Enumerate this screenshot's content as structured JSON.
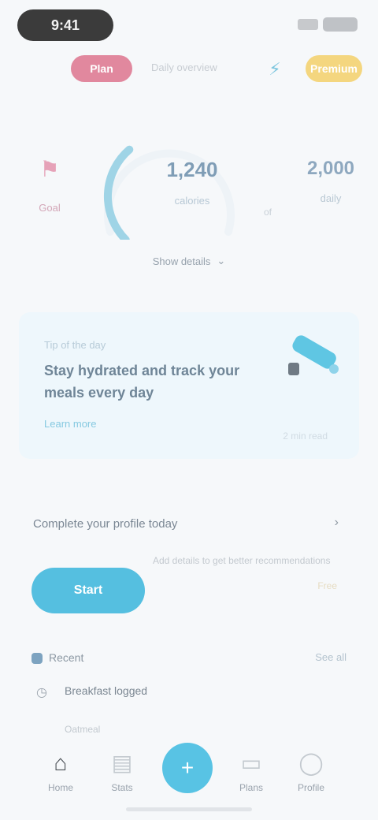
{
  "statusbar": {
    "time": "9:41",
    "signal_icon": "signal-icon",
    "battery_icon": "battery-icon"
  },
  "header": {
    "left_chip": "Plan",
    "center_text": "Daily overview",
    "right_icon": "bolt-icon",
    "right_chip": "Premium"
  },
  "dashboard": {
    "left_stat_label": "Goal",
    "gauge_progress": 0.35,
    "mid_stat_value": "1,240",
    "mid_stat_label": "calories",
    "separator_text": "of",
    "right_stat_value": "2,000",
    "right_stat_label": "daily",
    "details_toggle": "Show details"
  },
  "promo": {
    "subtitle": "Tip of the day",
    "title": "Stay hydrated and track your meals every day",
    "link": "Learn more",
    "meta": "2 min read"
  },
  "info": {
    "heading": "Complete your profile today",
    "arrow": "›",
    "description": "Add details to get better recommendations",
    "cta_label": "Start",
    "note": "Free"
  },
  "section": {
    "title": "Recent",
    "more": "See all",
    "items": [
      {
        "icon": "clock-icon",
        "label": "Breakfast logged"
      },
      {
        "icon": "note-icon",
        "label": "Oatmeal"
      }
    ]
  },
  "bottom_nav": {
    "items": [
      {
        "icon": "home-icon",
        "label": "Home"
      },
      {
        "icon": "chart-icon",
        "label": "Stats"
      },
      {
        "icon": "plus-icon",
        "label": ""
      },
      {
        "icon": "book-icon",
        "label": "Plans"
      },
      {
        "icon": "user-icon",
        "label": "Profile"
      }
    ]
  },
  "colors": {
    "accent": "#55bfe0",
    "pink": "#e1889e",
    "yellow": "#f4d67f",
    "card_bg": "#eef7fc"
  }
}
